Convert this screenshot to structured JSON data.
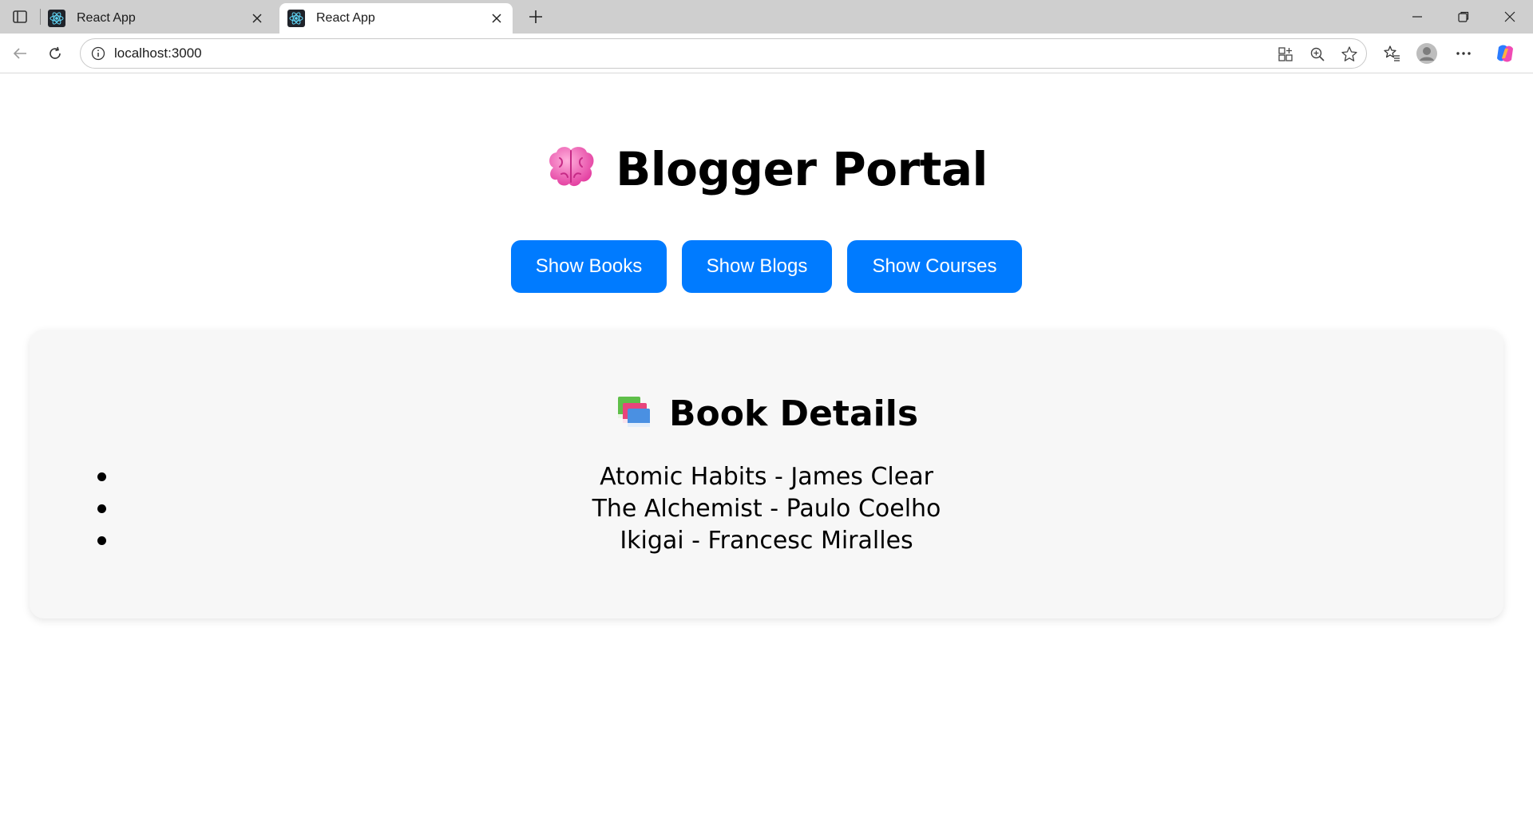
{
  "browser": {
    "tabs": [
      {
        "title": "React App",
        "active": false
      },
      {
        "title": "React App",
        "active": true
      }
    ],
    "address": "localhost:3000"
  },
  "page": {
    "title": "Blogger Portal",
    "title_icon": "brain-emoji",
    "buttons": [
      {
        "label": "Show Books"
      },
      {
        "label": "Show Blogs"
      },
      {
        "label": "Show Courses"
      }
    ],
    "accent_color": "#007bff",
    "card": {
      "title": "Book Details",
      "title_icon": "books-emoji",
      "items": [
        "Atomic Habits - James Clear",
        "The Alchemist - Paulo Coelho",
        "Ikigai - Francesc Miralles"
      ]
    }
  }
}
